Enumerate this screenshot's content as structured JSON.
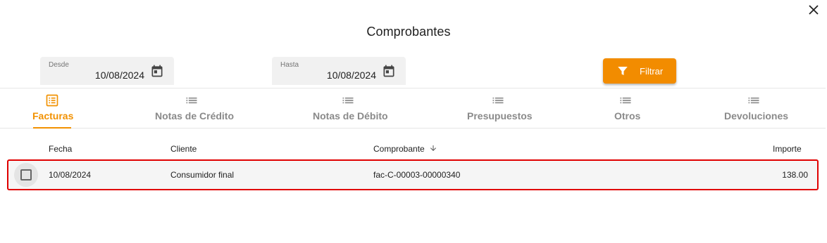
{
  "dialog": {
    "title": "Comprobantes",
    "close_icon": "close-icon"
  },
  "filters": {
    "desde": {
      "label": "Desde",
      "value": "10/08/2024",
      "icon": "calendar-icon"
    },
    "hasta": {
      "label": "Hasta",
      "value": "10/08/2024",
      "icon": "calendar-icon"
    },
    "filter_button": {
      "label": "Filtrar",
      "icon": "filter-icon",
      "color": "#f28c00"
    }
  },
  "tabs": [
    {
      "label": "Facturas",
      "icon": "receipt-list-icon",
      "active": true
    },
    {
      "label": "Notas de Crédito",
      "icon": "list-icon",
      "active": false
    },
    {
      "label": "Notas de Débito",
      "icon": "list-icon",
      "active": false
    },
    {
      "label": "Presupuestos",
      "icon": "list-icon",
      "active": false
    },
    {
      "label": "Otros",
      "icon": "list-icon",
      "active": false
    },
    {
      "label": "Devoluciones",
      "icon": "list-icon",
      "active": false
    }
  ],
  "accent_color": "#f29100",
  "table": {
    "columns": {
      "fecha": "Fecha",
      "cliente": "Cliente",
      "comprobante": "Comprobante",
      "importe": "Importe"
    },
    "sort_icon": "arrow-down-icon",
    "rows": [
      {
        "fecha": "10/08/2024",
        "cliente": "Consumidor final",
        "comprobante": "fac-C-00003-00000340",
        "importe": "138.00"
      }
    ]
  },
  "highlight_color": "#e00000"
}
